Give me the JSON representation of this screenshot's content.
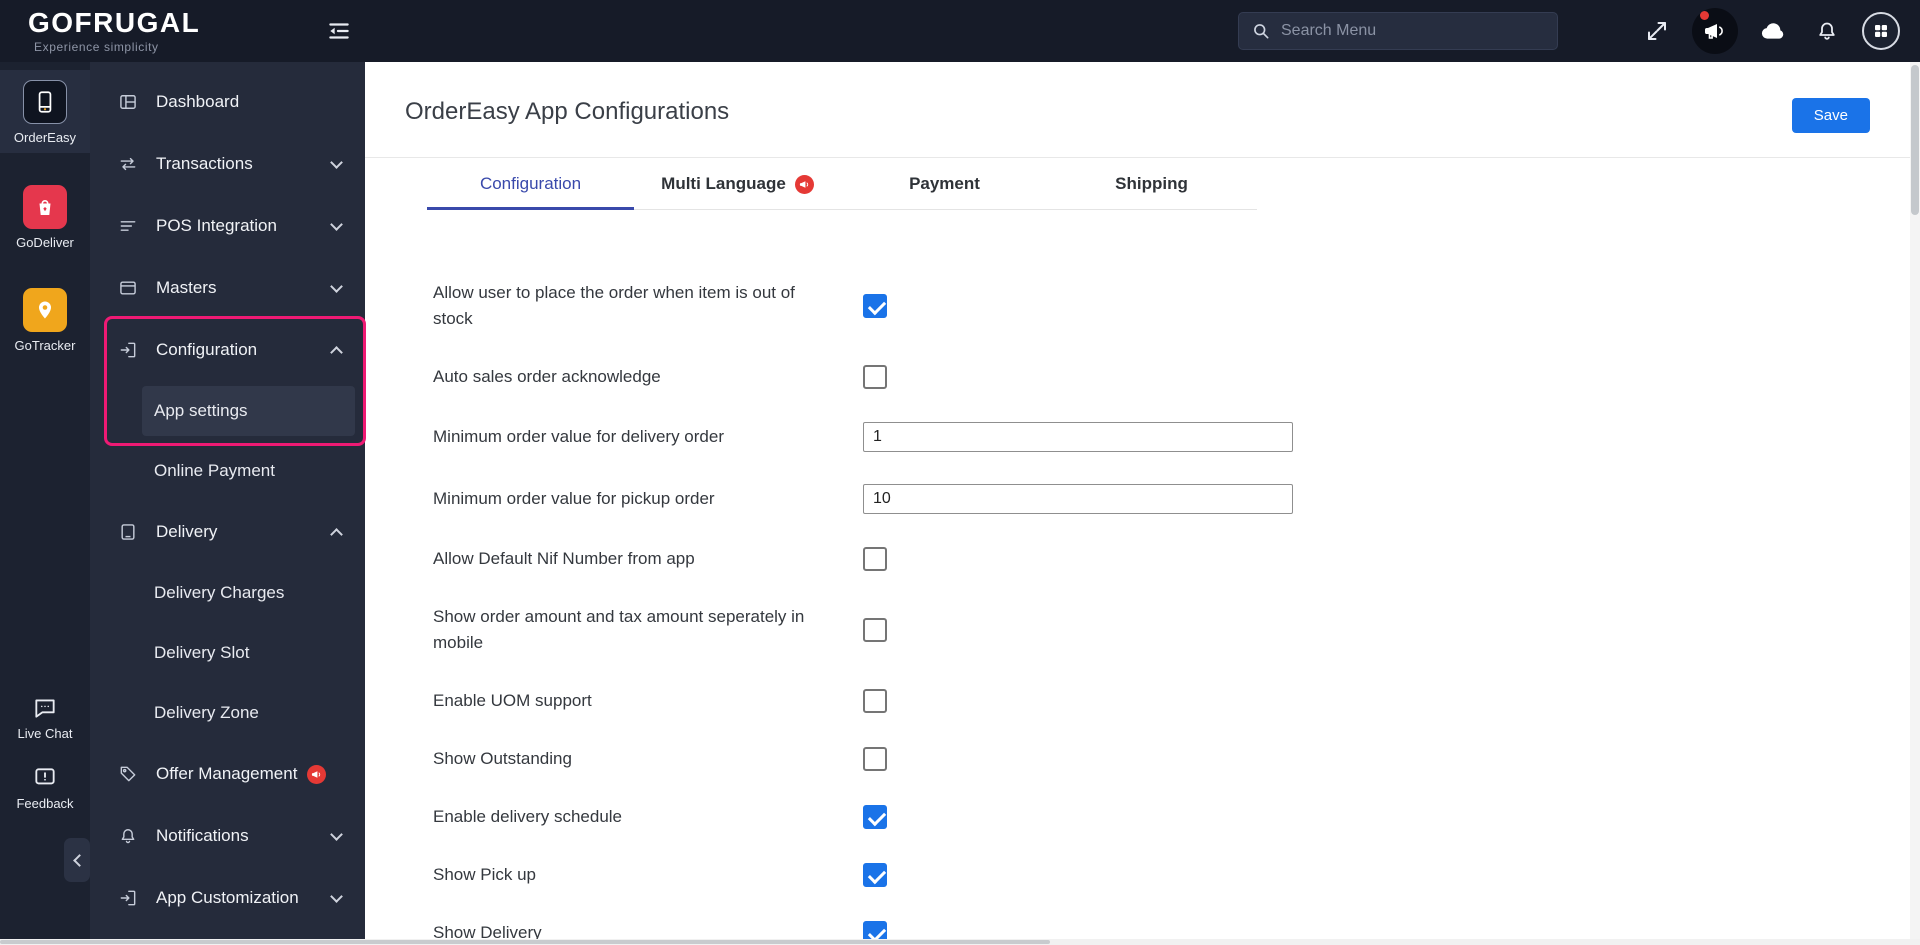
{
  "colors": {
    "accent_blue": "#1a73e8",
    "tab_active_blue": "#3949ab",
    "annotation_pink": "#ef1a74",
    "badge_red": "#e53935",
    "topbar_bg": "#161b28",
    "rail_bg": "#1c2230",
    "sidebar_bg": "#252b3b"
  },
  "topbar": {
    "logo_text": "GOFRUGAL",
    "tagline": "Experience simplicity",
    "search_placeholder": "Search Menu"
  },
  "rail": {
    "apps": [
      {
        "label": "OrderEasy",
        "active": true
      },
      {
        "label": "GoDeliver",
        "active": false
      },
      {
        "label": "GoTracker",
        "active": false
      }
    ],
    "utilities": [
      {
        "label": "Live Chat"
      },
      {
        "label": "Feedback"
      }
    ]
  },
  "sidebar": {
    "items": [
      {
        "label": "Dashboard"
      },
      {
        "label": "Transactions",
        "expandable": true,
        "expanded": false
      },
      {
        "label": "POS Integration",
        "expandable": true,
        "expanded": false
      },
      {
        "label": "Masters",
        "expandable": true,
        "expanded": false
      },
      {
        "label": "Configuration",
        "expandable": true,
        "expanded": true,
        "children": [
          {
            "label": "App settings",
            "active": true
          },
          {
            "label": "Online Payment",
            "active": false
          }
        ]
      },
      {
        "label": "Delivery",
        "expandable": true,
        "expanded": true,
        "children": [
          {
            "label": "Delivery Charges"
          },
          {
            "label": "Delivery Slot"
          },
          {
            "label": "Delivery Zone"
          }
        ]
      },
      {
        "label": "Offer Management",
        "badge": true
      },
      {
        "label": "Notifications",
        "expandable": true,
        "expanded": false
      },
      {
        "label": "App Customization",
        "expandable": true,
        "expanded": false
      }
    ]
  },
  "main": {
    "title": "OrderEasy App Configurations",
    "save_button": "Save",
    "tabs": [
      {
        "label": "Configuration",
        "active": true
      },
      {
        "label": "Multi Language",
        "badge": true
      },
      {
        "label": "Payment"
      },
      {
        "label": "Shipping"
      }
    ],
    "settings": [
      {
        "label": "Allow user to place the order when item is out of stock",
        "control": "checkbox",
        "checked": true
      },
      {
        "label": "Auto sales order acknowledge",
        "control": "checkbox",
        "checked": false
      },
      {
        "label": "Minimum order value for delivery order",
        "control": "input",
        "value": "1"
      },
      {
        "label": "Minimum order value for pickup order",
        "control": "input",
        "value": "10"
      },
      {
        "label": "Allow Default Nif Number from app",
        "control": "checkbox",
        "checked": false
      },
      {
        "label": "Show order amount and tax amount seperately in mobile",
        "control": "checkbox",
        "checked": false
      },
      {
        "label": "Enable UOM support",
        "control": "checkbox",
        "checked": false
      },
      {
        "label": "Show Outstanding",
        "control": "checkbox",
        "checked": false
      },
      {
        "label": "Enable delivery schedule",
        "control": "checkbox",
        "checked": true
      },
      {
        "label": "Show Pick up",
        "control": "checkbox",
        "checked": true
      },
      {
        "label": "Show Delivery",
        "control": "checkbox",
        "checked": true
      }
    ]
  }
}
